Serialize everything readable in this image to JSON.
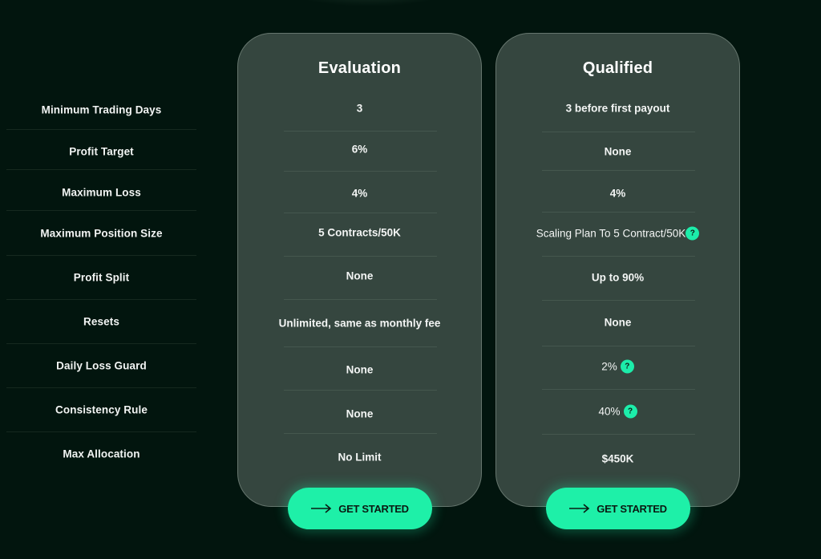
{
  "rows": [
    {
      "label": "Minimum Trading Days"
    },
    {
      "label": "Profit Target"
    },
    {
      "label": "Maximum Loss"
    },
    {
      "label": "Maximum Position Size"
    },
    {
      "label": "Profit Split"
    },
    {
      "label": "Resets"
    },
    {
      "label": "Daily Loss Guard"
    },
    {
      "label": "Consistency Rule"
    },
    {
      "label": "Max Allocation"
    }
  ],
  "plans": [
    {
      "title": "Evaluation",
      "values": [
        "3",
        "6%",
        "4%",
        "5 Contracts/50K",
        "None",
        "Unlimited, same as monthly fee",
        "None",
        "None",
        "No Limit"
      ],
      "cta_label": "GET STARTED",
      "cta_icon": "arrow-right-icon"
    },
    {
      "title": "Qualified",
      "values": [
        "3 before first payout",
        "None",
        "4%",
        "Scaling Plan To 5 Contract/50K",
        "Up to 90%",
        "None",
        "2%",
        "40%",
        "$450K"
      ],
      "help_on_rows": [
        3,
        6,
        7
      ],
      "help_icon_label": "?",
      "cta_label": "GET STARTED",
      "cta_icon": "arrow-right-icon"
    }
  ],
  "colors": {
    "background": "#02150e",
    "card": "#35463f",
    "accent": "#1ef0a8"
  }
}
